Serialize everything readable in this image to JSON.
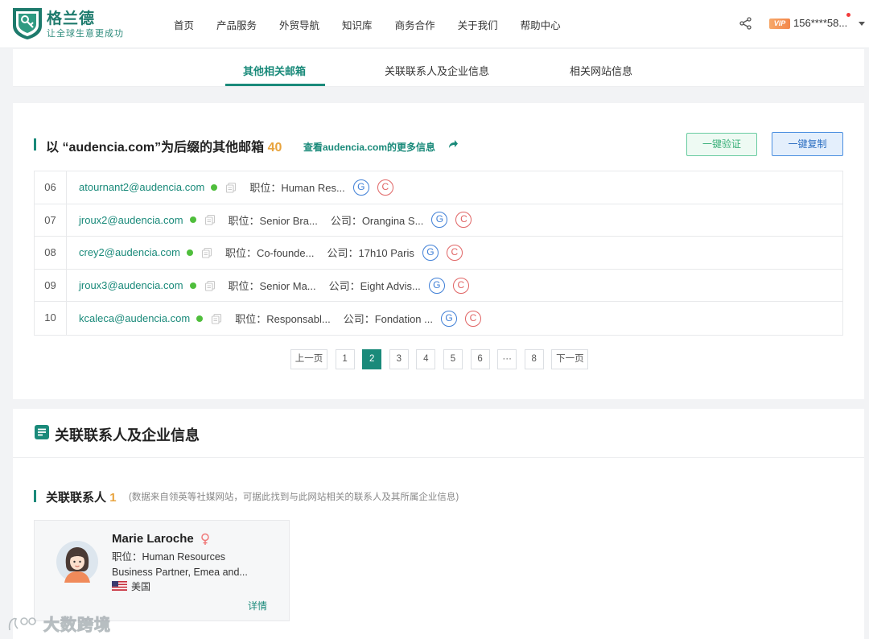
{
  "header": {
    "brand_name": "格兰德",
    "brand_slogan": "让全球生意更成功",
    "nav": [
      "首页",
      "产品服务",
      "外贸导航",
      "知识库",
      "商务合作",
      "关于我们",
      "帮助中心"
    ],
    "vip_badge": "VIP",
    "user": "156****58..."
  },
  "tabs": [
    {
      "label": "其他相关邮箱",
      "active": true
    },
    {
      "label": "关联联系人及企业信息",
      "active": false
    },
    {
      "label": "相关网站信息",
      "active": false
    }
  ],
  "emails_section": {
    "title": "以 “audencia.com”为后缀的其他邮箱",
    "count": "40",
    "more_link": "查看audencia.com的更多信息",
    "verify_button": "一键验证",
    "copy_button": "一键复制",
    "rows": [
      {
        "idx": "06",
        "email": "atournant2@audencia.com",
        "position": "职位：Human Res...",
        "company": ""
      },
      {
        "idx": "07",
        "email": "jroux2@audencia.com",
        "position": "职位：Senior Bra...",
        "company": "公司：Orangina S..."
      },
      {
        "idx": "08",
        "email": "crey2@audencia.com",
        "position": "职位：Co-founde...",
        "company": "公司：17h10 Paris"
      },
      {
        "idx": "09",
        "email": "jroux3@audencia.com",
        "position": "职位：Senior Ma...",
        "company": "公司：Eight Advis..."
      },
      {
        "idx": "10",
        "email": "kcaleca@audencia.com",
        "position": "职位：Responsabl...",
        "company": "公司：Fondation ..."
      }
    ],
    "g_label": "G",
    "c_label": "C"
  },
  "pagination": {
    "prev": "上一页",
    "pages": [
      "1",
      "2",
      "3",
      "4",
      "5",
      "6",
      "···",
      "8"
    ],
    "current": "2",
    "next": "下一页"
  },
  "related": {
    "title": "关联联系人及企业信息",
    "contacts_title": "关联联系人",
    "contacts_count": "1",
    "contacts_note": "(数据来自领英等社媒网站，可据此找到与此网站相关的联系人及其所属企业信息)",
    "person": {
      "name": "Marie Laroche",
      "job_line1": "职位：Human Resources",
      "job_line2": "Business Partner, Emea and...",
      "country": "美国",
      "detail_link": "详情"
    }
  },
  "watermark": "大数跨境",
  "colors": {
    "brand": "#1a8a7a",
    "accent": "#e8a33d",
    "verify": "#3bb07a",
    "copy": "#2d6fc2"
  }
}
